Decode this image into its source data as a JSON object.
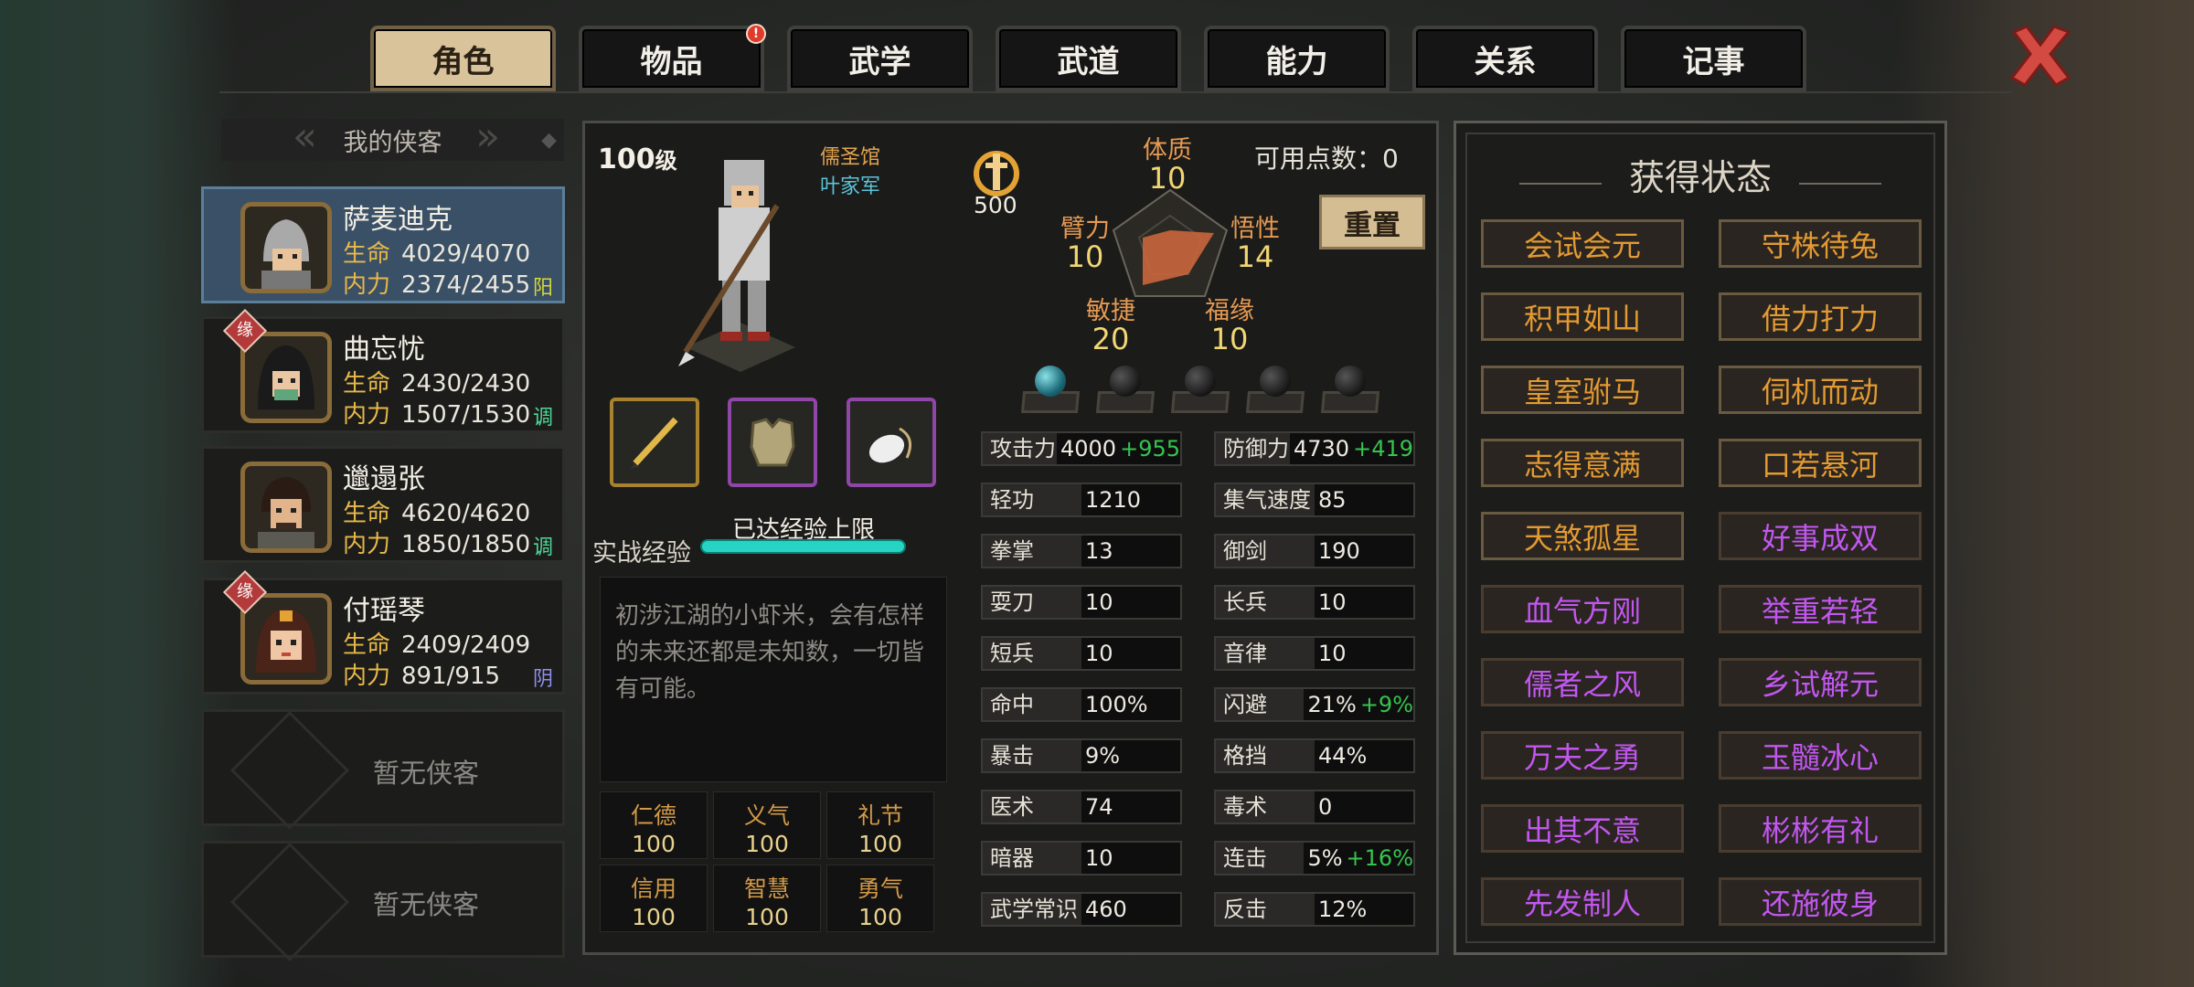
{
  "tabs": [
    {
      "label": "角色",
      "active": true
    },
    {
      "label": "物品",
      "badge": "!"
    },
    {
      "label": "武学"
    },
    {
      "label": "武道"
    },
    {
      "label": "能力"
    },
    {
      "label": "关系"
    },
    {
      "label": "记事"
    }
  ],
  "close_icon": "close-x-icon",
  "party": {
    "header": "我的侠客",
    "members": [
      {
        "name": "萨麦迪克",
        "hp_label": "生命",
        "hp": "4029/4070",
        "mp_label": "内力",
        "mp": "2374/2455",
        "tag": "阳",
        "tag_color": "#d8d838",
        "selected": true
      },
      {
        "name": "曲忘忧",
        "hp_label": "生命",
        "hp": "2430/2430",
        "mp_label": "内力",
        "mp": "1507/1530",
        "tag": "调",
        "tag_color": "#4fd89a",
        "badge": "缘"
      },
      {
        "name": "邋遢张",
        "hp_label": "生命",
        "hp": "4620/4620",
        "mp_label": "内力",
        "mp": "1850/1850",
        "tag": "调",
        "tag_color": "#4fd89a"
      },
      {
        "name": "付瑶琴",
        "hp_label": "生命",
        "hp": "2409/2409",
        "mp_label": "内力",
        "mp": "891/915",
        "tag": "阴",
        "tag_color": "#8f8ff0",
        "badge": "缘"
      }
    ],
    "empty_label": "暂无侠客"
  },
  "character": {
    "level": "100",
    "level_unit": "级",
    "school": "儒圣馆",
    "family": "叶家军",
    "badge_value": "500",
    "available_points_label": "可用点数：",
    "available_points": "0",
    "reset_label": "重置",
    "attributes": {
      "constitution": {
        "label": "体质",
        "value": "10"
      },
      "strength": {
        "label": "臂力",
        "value": "10"
      },
      "wisdom": {
        "label": "悟性",
        "value": "14"
      },
      "agility": {
        "label": "敏捷",
        "value": "20"
      },
      "luck": {
        "label": "福缘",
        "value": "10"
      }
    },
    "exp_label": "实战经验",
    "exp_status": "已达经验上限",
    "exp_fill": 1.0,
    "description": "初涉江湖的小虾米，会有怎样的未来还都是未知数，一切皆有可能。",
    "virtues": [
      {
        "k": "仁德",
        "v": "100"
      },
      {
        "k": "义气",
        "v": "100"
      },
      {
        "k": "礼节",
        "v": "100"
      },
      {
        "k": "信用",
        "v": "100"
      },
      {
        "k": "智慧",
        "v": "100"
      },
      {
        "k": "勇气",
        "v": "100"
      }
    ]
  },
  "stats_left": [
    {
      "k": "攻击力",
      "v": "4000",
      "b": "+955"
    },
    {
      "k": "轻功",
      "v": "1210"
    },
    {
      "k": "拳掌",
      "v": "13"
    },
    {
      "k": "耍刀",
      "v": "10"
    },
    {
      "k": "短兵",
      "v": "10"
    },
    {
      "k": "命中",
      "v": "100%"
    },
    {
      "k": "暴击",
      "v": "9%"
    },
    {
      "k": "医术",
      "v": "74"
    },
    {
      "k": "暗器",
      "v": "10"
    },
    {
      "k": "武学常识",
      "v": "460"
    }
  ],
  "stats_right": [
    {
      "k": "防御力",
      "v": "4730",
      "b": "+419"
    },
    {
      "k": "集气速度",
      "v": "85"
    },
    {
      "k": "御剑",
      "v": "190"
    },
    {
      "k": "长兵",
      "v": "10"
    },
    {
      "k": "音律",
      "v": "10"
    },
    {
      "k": "闪避",
      "v": "21%",
      "b": "+9%"
    },
    {
      "k": "格挡",
      "v": "44%"
    },
    {
      "k": "毒术",
      "v": "0"
    },
    {
      "k": "连击",
      "v": "5%",
      "b": "+16%"
    },
    {
      "k": "反击",
      "v": "12%"
    }
  ],
  "status_panel": {
    "title": "获得状态",
    "items": [
      {
        "t": "会试会元",
        "c": "orange"
      },
      {
        "t": "守株待兔",
        "c": "orange"
      },
      {
        "t": "积甲如山",
        "c": "orange"
      },
      {
        "t": "借力打力",
        "c": "orange"
      },
      {
        "t": "皇室驸马",
        "c": "orange"
      },
      {
        "t": "伺机而动",
        "c": "orange"
      },
      {
        "t": "志得意满",
        "c": "orange"
      },
      {
        "t": "口若悬河",
        "c": "orange"
      },
      {
        "t": "天煞孤星",
        "c": "orange"
      },
      {
        "t": "好事成双",
        "c": "purple"
      },
      {
        "t": "血气方刚",
        "c": "purple"
      },
      {
        "t": "举重若轻",
        "c": "purple"
      },
      {
        "t": "儒者之风",
        "c": "purple"
      },
      {
        "t": "乡试解元",
        "c": "purple"
      },
      {
        "t": "万夫之勇",
        "c": "purple"
      },
      {
        "t": "玉髓冰心",
        "c": "purple"
      },
      {
        "t": "出其不意",
        "c": "purple"
      },
      {
        "t": "彬彬有礼",
        "c": "purple"
      },
      {
        "t": "先发制人",
        "c": "purple"
      },
      {
        "t": "还施彼身",
        "c": "purple"
      }
    ]
  }
}
